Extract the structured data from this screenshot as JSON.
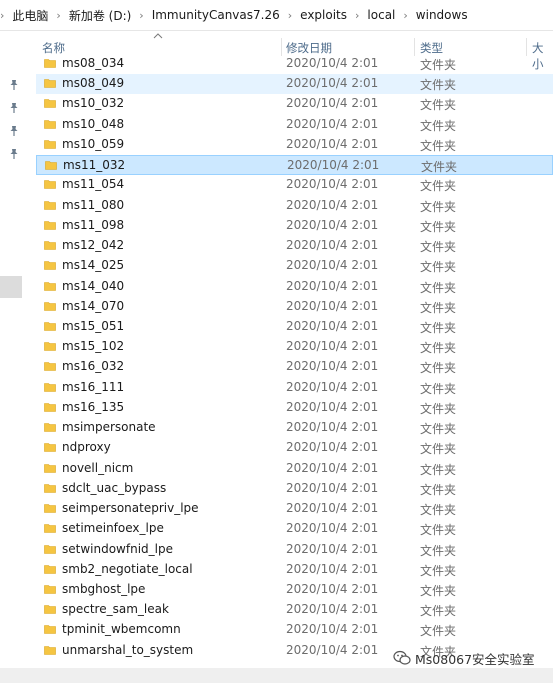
{
  "breadcrumb": {
    "items": [
      "此电脑",
      "新加卷 (D:)",
      "ImmunityCanvas7.26",
      "exploits",
      "local",
      "windows"
    ]
  },
  "columns": {
    "name": "名称",
    "date": "修改日期",
    "type": "类型",
    "size": "大小"
  },
  "colors": {
    "selected_bg": "#cce8ff",
    "hover_bg": "#e5f3ff",
    "folder": "#f5c542",
    "header_text": "#4d6b8a"
  },
  "files": [
    {
      "name": "ms08_034",
      "date": "2020/10/4 2:01",
      "type": "文件夹"
    },
    {
      "name": "ms08_049",
      "date": "2020/10/4 2:01",
      "type": "文件夹",
      "state": "hover"
    },
    {
      "name": "ms10_032",
      "date": "2020/10/4 2:01",
      "type": "文件夹"
    },
    {
      "name": "ms10_048",
      "date": "2020/10/4 2:01",
      "type": "文件夹"
    },
    {
      "name": "ms10_059",
      "date": "2020/10/4 2:01",
      "type": "文件夹"
    },
    {
      "name": "ms11_032",
      "date": "2020/10/4 2:01",
      "type": "文件夹",
      "state": "selected"
    },
    {
      "name": "ms11_054",
      "date": "2020/10/4 2:01",
      "type": "文件夹"
    },
    {
      "name": "ms11_080",
      "date": "2020/10/4 2:01",
      "type": "文件夹"
    },
    {
      "name": "ms11_098",
      "date": "2020/10/4 2:01",
      "type": "文件夹"
    },
    {
      "name": "ms12_042",
      "date": "2020/10/4 2:01",
      "type": "文件夹"
    },
    {
      "name": "ms14_025",
      "date": "2020/10/4 2:01",
      "type": "文件夹"
    },
    {
      "name": "ms14_040",
      "date": "2020/10/4 2:01",
      "type": "文件夹"
    },
    {
      "name": "ms14_070",
      "date": "2020/10/4 2:01",
      "type": "文件夹"
    },
    {
      "name": "ms15_051",
      "date": "2020/10/4 2:01",
      "type": "文件夹"
    },
    {
      "name": "ms15_102",
      "date": "2020/10/4 2:01",
      "type": "文件夹"
    },
    {
      "name": "ms16_032",
      "date": "2020/10/4 2:01",
      "type": "文件夹"
    },
    {
      "name": "ms16_111",
      "date": "2020/10/4 2:01",
      "type": "文件夹"
    },
    {
      "name": "ms16_135",
      "date": "2020/10/4 2:01",
      "type": "文件夹"
    },
    {
      "name": "msimpersonate",
      "date": "2020/10/4 2:01",
      "type": "文件夹"
    },
    {
      "name": "ndproxy",
      "date": "2020/10/4 2:01",
      "type": "文件夹"
    },
    {
      "name": "novell_nicm",
      "date": "2020/10/4 2:01",
      "type": "文件夹"
    },
    {
      "name": "sdclt_uac_bypass",
      "date": "2020/10/4 2:01",
      "type": "文件夹"
    },
    {
      "name": "seimpersonatepriv_lpe",
      "date": "2020/10/4 2:01",
      "type": "文件夹"
    },
    {
      "name": "setimeinfoex_lpe",
      "date": "2020/10/4 2:01",
      "type": "文件夹"
    },
    {
      "name": "setwindowfnid_lpe",
      "date": "2020/10/4 2:01",
      "type": "文件夹"
    },
    {
      "name": "smb2_negotiate_local",
      "date": "2020/10/4 2:01",
      "type": "文件夹"
    },
    {
      "name": "smbghost_lpe",
      "date": "2020/10/4 2:01",
      "type": "文件夹"
    },
    {
      "name": "spectre_sam_leak",
      "date": "2020/10/4 2:01",
      "type": "文件夹"
    },
    {
      "name": "tpminit_wbemcomn",
      "date": "2020/10/4 2:01",
      "type": "文件夹"
    },
    {
      "name": "unmarshal_to_system",
      "date": "2020/10/4 2:01",
      "type": "文件夹"
    }
  ],
  "quick_access_pins": [
    "pin-icon",
    "pin-icon",
    "pin-icon",
    "pin-icon"
  ],
  "watermark": {
    "text": "Ms08067安全实验室",
    "icon": "wechat-icon"
  }
}
